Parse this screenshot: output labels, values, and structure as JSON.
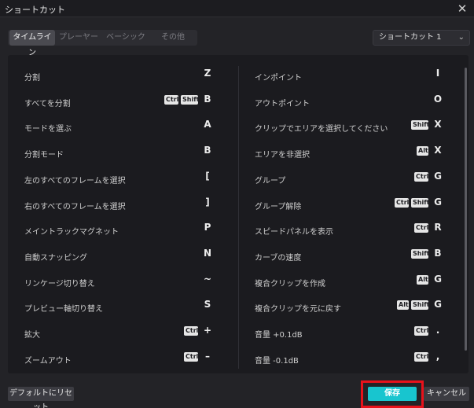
{
  "window": {
    "title": "ショートカット",
    "close_glyph": "✕"
  },
  "tabs": [
    {
      "label": "タイムライン",
      "active": true
    },
    {
      "label": "プレーヤー",
      "active": false
    },
    {
      "label": "ベーシック",
      "active": false
    },
    {
      "label": "その他",
      "active": false
    }
  ],
  "preset": {
    "value": "ショートカット 1",
    "chevron_icon": "chevron-down-icon"
  },
  "left_shortcuts": [
    {
      "action": "分割",
      "mods": [],
      "key": "Z"
    },
    {
      "action": "すべてを分割",
      "mods": [
        "Ctrl",
        "Shift"
      ],
      "key": "B"
    },
    {
      "action": "モードを選ぶ",
      "mods": [],
      "key": "A"
    },
    {
      "action": "分割モード",
      "mods": [],
      "key": "B"
    },
    {
      "action": "左のすべてのフレームを選択",
      "mods": [],
      "key": "["
    },
    {
      "action": "右のすべてのフレームを選択",
      "mods": [],
      "key": "]"
    },
    {
      "action": "メイントラックマグネット",
      "mods": [],
      "key": "P"
    },
    {
      "action": "自動スナッピング",
      "mods": [],
      "key": "N"
    },
    {
      "action": "リンケージ切り替え",
      "mods": [],
      "key": "~"
    },
    {
      "action": "プレビュー軸切り替え",
      "mods": [],
      "key": "S"
    },
    {
      "action": "拡大",
      "mods": [
        "Ctrl"
      ],
      "key": "+"
    },
    {
      "action": "ズームアウト",
      "mods": [
        "Ctrl"
      ],
      "key": "–"
    }
  ],
  "right_shortcuts": [
    {
      "action": "インポイント",
      "mods": [],
      "key": "I"
    },
    {
      "action": "アウトポイント",
      "mods": [],
      "key": "O"
    },
    {
      "action": "クリップでエリアを選択してください",
      "mods": [
        "Shift"
      ],
      "key": "X"
    },
    {
      "action": "エリアを非選択",
      "mods": [
        "Alt"
      ],
      "key": "X"
    },
    {
      "action": "グループ",
      "mods": [
        "Ctrl"
      ],
      "key": "G"
    },
    {
      "action": "グループ解除",
      "mods": [
        "Ctrl",
        "Shift"
      ],
      "key": "G"
    },
    {
      "action": "スピードパネルを表示",
      "mods": [
        "Ctrl"
      ],
      "key": "R"
    },
    {
      "action": "カーブの速度",
      "mods": [
        "Shift"
      ],
      "key": "B"
    },
    {
      "action": "複合クリップを作成",
      "mods": [
        "Alt"
      ],
      "key": "G"
    },
    {
      "action": "複合クリップを元に戻す",
      "mods": [
        "Alt",
        "Shift"
      ],
      "key": "G"
    },
    {
      "action": "音量 +0.1dB",
      "mods": [
        "Ctrl"
      ],
      "key": "."
    },
    {
      "action": "音量 -0.1dB",
      "mods": [
        "Ctrl"
      ],
      "key": ","
    }
  ],
  "footer": {
    "reset_label": "デフォルトにリセット",
    "save_label": "保存",
    "cancel_label": "キャンセル"
  },
  "colors": {
    "accent": "#18c5cf",
    "highlight_border": "#e8121b",
    "background": "#232327",
    "panel": "#1b1b1f"
  }
}
